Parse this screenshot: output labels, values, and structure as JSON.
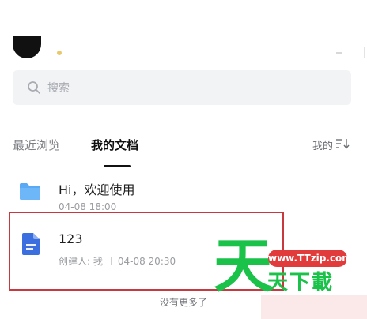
{
  "search": {
    "placeholder": "搜索"
  },
  "tabs": [
    {
      "label": "最近浏览",
      "active": false
    },
    {
      "label": "我的文档",
      "active": true
    }
  ],
  "filter": {
    "label": "我的"
  },
  "files": [
    {
      "title": "Hi，欢迎使用",
      "time": "04-08 18:00",
      "icon": "folder-icon"
    },
    {
      "title": "123",
      "creator": "创建人: 我",
      "time": "04-08 20:30",
      "icon": "document-icon"
    }
  ],
  "footer": {
    "no_more": "没有更多了"
  },
  "watermark": {
    "big_char": "天",
    "url": "www.TTzip.com",
    "sub": "天下載"
  },
  "colors": {
    "folder": "#5aa9f5",
    "document": "#3b6fe0",
    "highlight": "#c7393f",
    "watermark_green": "#1ac24a",
    "watermark_red": "#e23b3b"
  }
}
